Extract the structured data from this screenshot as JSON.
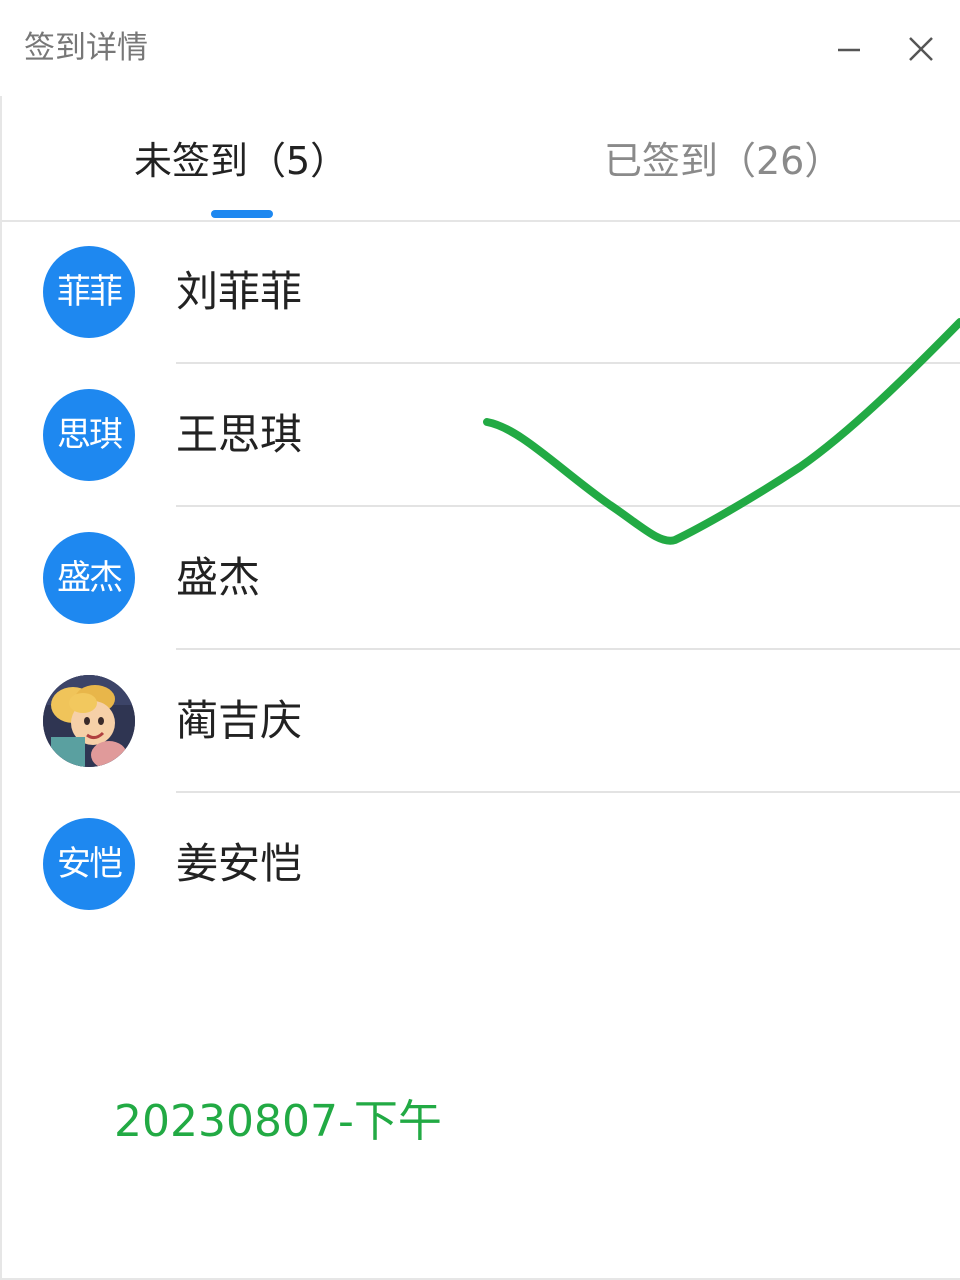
{
  "window": {
    "title": "签到详情"
  },
  "tabs": [
    {
      "label": "未签到（5）",
      "active": true
    },
    {
      "label": "已签到（26）",
      "active": false
    }
  ],
  "people": [
    {
      "avatar_text": "菲菲",
      "name": "刘菲菲",
      "avatar_type": "initials"
    },
    {
      "avatar_text": "思琪",
      "name": "王思琪",
      "avatar_type": "initials"
    },
    {
      "avatar_text": "盛杰",
      "name": "盛杰",
      "avatar_type": "initials"
    },
    {
      "avatar_text": "",
      "name": "蔺吉庆",
      "avatar_type": "photo"
    },
    {
      "avatar_text": "安恺",
      "name": "姜安恺",
      "avatar_type": "initials"
    }
  ],
  "annotation": {
    "stamp_text": "20230807-下午"
  },
  "colors": {
    "accent": "#1e88f0",
    "annotation": "#22aa44",
    "text": "#222222",
    "muted": "#8a8a8a"
  }
}
